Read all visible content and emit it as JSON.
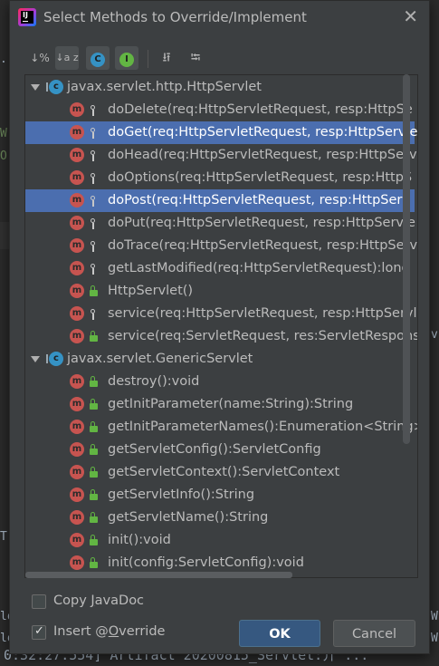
{
  "background": {
    "fragments": [
      ".",
      "W",
      "O",
      "T",
      "lo",
      "lo",
      "lo"
    ],
    "right_fragments": [
      "W",
      "W",
      "v"
    ],
    "bottom_log": "0:32:27.554] Artifact 20200815_Servlet:介 ..."
  },
  "dialog": {
    "title": "Select Methods to Override/Implement",
    "close_icon": "✕"
  },
  "toolbar": {
    "sort_by_visibility": "↓%",
    "sort_alpha": "↓a z",
    "show_classes": "C",
    "show_interfaces": "I",
    "expand_all": "⭿",
    "collapse_all": "⭾"
  },
  "tree": {
    "groups": [
      {
        "class_name": "javax.servlet.http.HttpServlet",
        "methods": [
          {
            "label": "doDelete(req:HttpServletRequest, resp:HttpSe",
            "visibility": "protected",
            "selected": false
          },
          {
            "label": "doGet(req:HttpServletRequest, resp:HttpServle",
            "visibility": "protected",
            "selected": true
          },
          {
            "label": "doHead(req:HttpServletRequest, resp:HttpServ",
            "visibility": "protected",
            "selected": false
          },
          {
            "label": "doOptions(req:HttpServletRequest, resp:HttpS",
            "visibility": "protected",
            "selected": false
          },
          {
            "label": "doPost(req:HttpServletRequest, resp:HttpServ",
            "visibility": "protected",
            "selected": true
          },
          {
            "label": "doPut(req:HttpServletRequest, resp:HttpServle",
            "visibility": "protected",
            "selected": false
          },
          {
            "label": "doTrace(req:HttpServletRequest, resp:HttpServ",
            "visibility": "protected",
            "selected": false
          },
          {
            "label": "getLastModified(req:HttpServletRequest):long",
            "visibility": "protected",
            "selected": false
          },
          {
            "label": "HttpServlet()",
            "visibility": "public",
            "selected": false
          },
          {
            "label": "service(req:HttpServletRequest, resp:HttpServl",
            "visibility": "protected",
            "selected": false
          },
          {
            "label": "service(req:ServletRequest, res:ServletResponse):v",
            "visibility": "public",
            "selected": false
          }
        ]
      },
      {
        "class_name": "javax.servlet.GenericServlet",
        "methods": [
          {
            "label": "destroy():void",
            "visibility": "public",
            "selected": false
          },
          {
            "label": "getInitParameter(name:String):String",
            "visibility": "public",
            "selected": false
          },
          {
            "label": "getInitParameterNames():Enumeration<String>",
            "visibility": "public",
            "selected": false
          },
          {
            "label": "getServletConfig():ServletConfig",
            "visibility": "public",
            "selected": false
          },
          {
            "label": "getServletContext():ServletContext",
            "visibility": "public",
            "selected": false
          },
          {
            "label": "getServletInfo():String",
            "visibility": "public",
            "selected": false
          },
          {
            "label": "getServletName():String",
            "visibility": "public",
            "selected": false
          },
          {
            "label": "init():void",
            "visibility": "public",
            "selected": false
          },
          {
            "label": "init(config:ServletConfig):void",
            "visibility": "public",
            "selected": false
          }
        ]
      }
    ],
    "method_icon_letter": "m",
    "class_icon_letter": "c",
    "colors": {
      "selection": "#4b6eaf",
      "method_icon": "#c75450",
      "class_icon": "#3592c4",
      "public_lock": "#62b543"
    }
  },
  "options": {
    "copy_javadoc": {
      "label_pre": "Copy ",
      "label_mnemonic": "J",
      "label_post": "avaDoc",
      "checked": false
    },
    "insert_override": {
      "label_pre": "Insert @",
      "label_mnemonic": "O",
      "label_post": "verride",
      "checked": true,
      "check_glyph": "✓"
    }
  },
  "buttons": {
    "ok": "OK",
    "cancel": "Cancel"
  }
}
